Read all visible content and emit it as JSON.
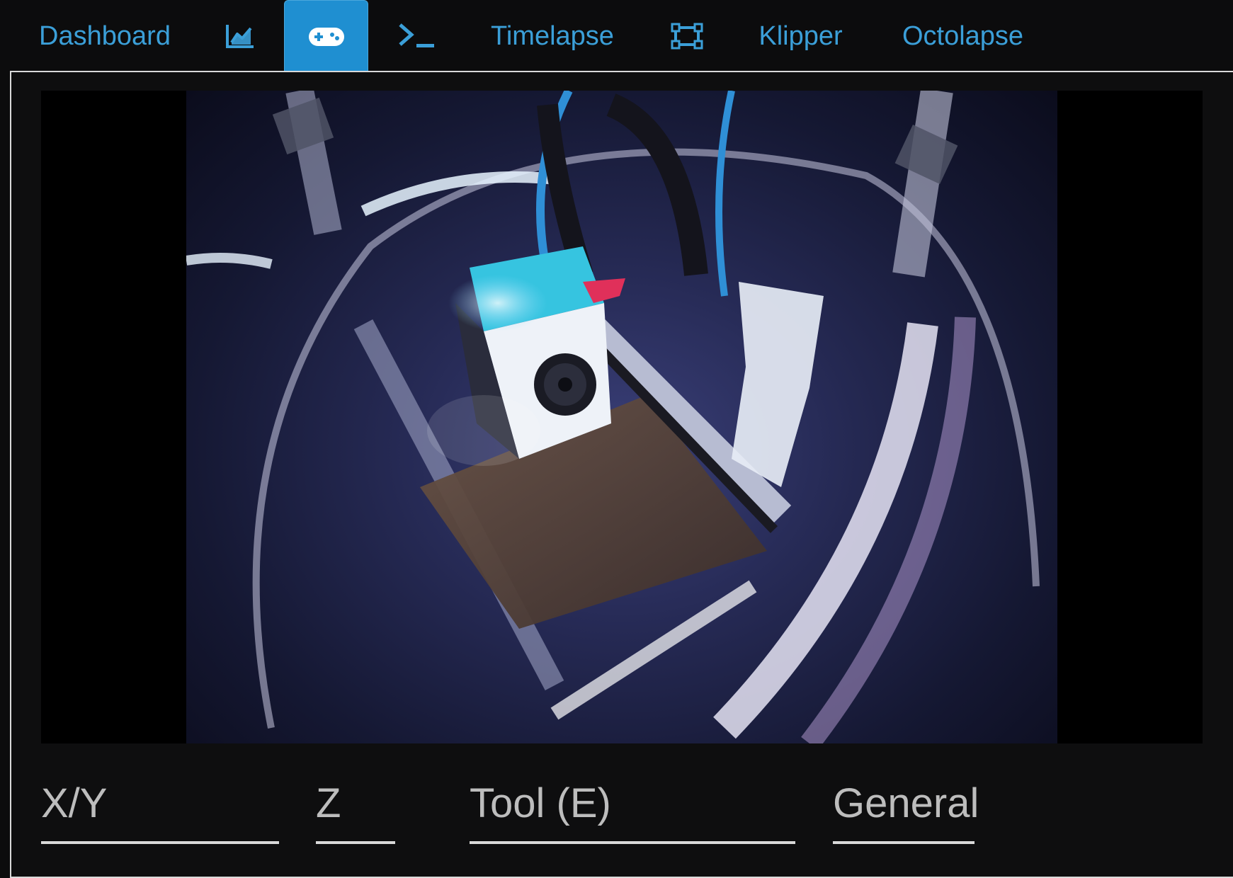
{
  "nav": {
    "dashboard_label": "Dashboard",
    "graph_icon": "chart-line-icon",
    "control_icon": "gamepad-icon",
    "terminal_icon": "terminal-icon",
    "timelapse_label": "Timelapse",
    "gcode_viewer_icon": "vector-square-icon",
    "klipper_label": "Klipper",
    "octolapse_label": "Octolapse",
    "active_tab": "control"
  },
  "webcam": {
    "description_icon": "webcam-stream"
  },
  "sections": {
    "xy_label": "X/Y",
    "z_label": "Z",
    "tool_label": "Tool (E)",
    "general_label": "General"
  },
  "colors": {
    "accent": "#3b9fd8",
    "active_tab_bg": "#1f8fd1",
    "background": "#0c0c0d",
    "section_text": "#bdbdbd"
  }
}
